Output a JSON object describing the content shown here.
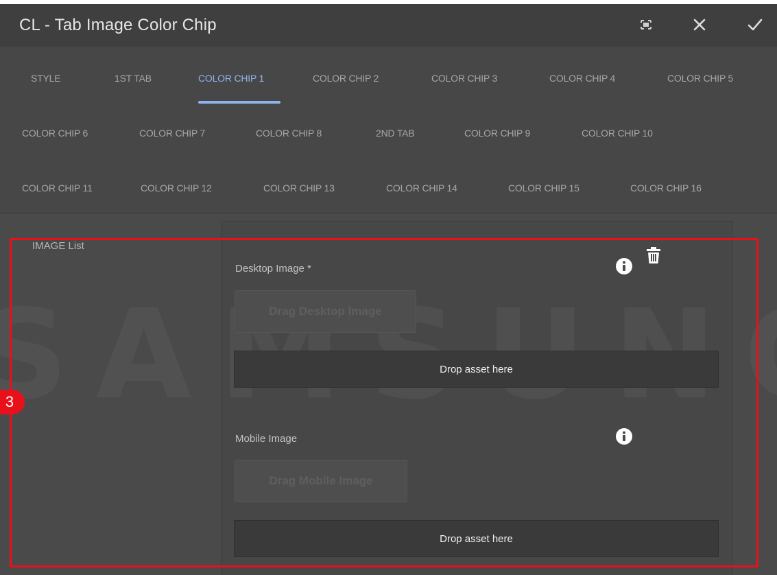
{
  "dialog": {
    "title": "CL - Tab Image Color Chip",
    "icons": {
      "fullscreen": "fullscreen-icon",
      "close": "close-icon",
      "done": "checkmark-icon"
    }
  },
  "tabs": [
    {
      "label": "STYLE",
      "active": false
    },
    {
      "label": "1ST TAB",
      "active": false
    },
    {
      "label": "COLOR CHIP 1",
      "active": true
    },
    {
      "label": "COLOR CHIP 2",
      "active": false
    },
    {
      "label": "COLOR CHIP 3",
      "active": false
    },
    {
      "label": "COLOR CHIP 4",
      "active": false
    },
    {
      "label": "COLOR CHIP 5",
      "active": false
    },
    {
      "label": "COLOR CHIP 6",
      "active": false
    },
    {
      "label": "COLOR CHIP 7",
      "active": false
    },
    {
      "label": "COLOR CHIP 8",
      "active": false
    },
    {
      "label": "2ND TAB",
      "active": false
    },
    {
      "label": "COLOR CHIP 9",
      "active": false
    },
    {
      "label": "COLOR CHIP 10",
      "active": false
    },
    {
      "label": "COLOR CHIP 11",
      "active": false
    },
    {
      "label": "COLOR CHIP 12",
      "active": false
    },
    {
      "label": "COLOR CHIP 13",
      "active": false
    },
    {
      "label": "COLOR CHIP 14",
      "active": false
    },
    {
      "label": "COLOR CHIP 15",
      "active": false
    },
    {
      "label": "COLOR CHIP 16",
      "active": false
    }
  ],
  "image_list": {
    "label": "IMAGE List",
    "watermark": "SAMSUNG",
    "desktop": {
      "label": "Desktop Image *",
      "drag_label": "Drag Desktop Image",
      "drop_label": "Drop asset here"
    },
    "mobile": {
      "label": "Mobile Image",
      "drag_label": "Drag Mobile Image",
      "drop_label": "Drop asset here"
    },
    "icons": {
      "info": "info-icon",
      "delete": "trash-icon"
    }
  },
  "annotation": {
    "badge": "3",
    "color": "#e8101a"
  },
  "colors": {
    "accent": "#8eb4ef",
    "background": "#4a4a4a",
    "titlebar": "#3f3f3f",
    "drop_zone": "#3a3a3a"
  }
}
